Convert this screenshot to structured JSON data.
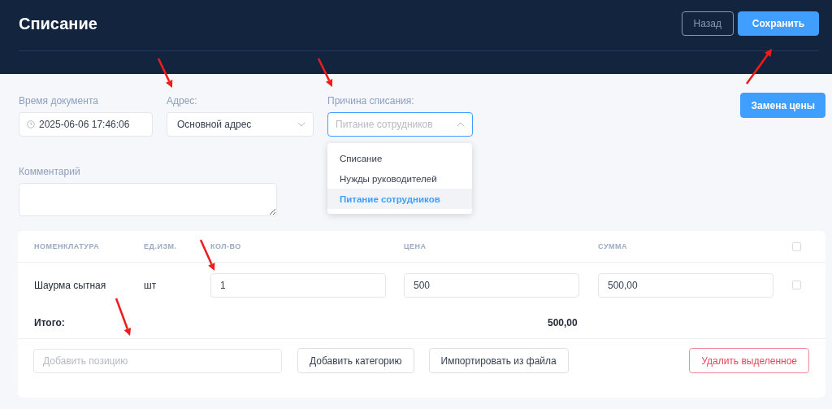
{
  "header": {
    "title": "Списание",
    "buttons": [
      {
        "label": "Назад",
        "kind": "outline"
      },
      {
        "label": "Сохранить",
        "kind": "primary"
      }
    ]
  },
  "form": {
    "time": {
      "label": "Время документа",
      "value": "2025-06-06 17:46:06"
    },
    "address": {
      "label": "Адрес:",
      "value": "Основной адрес",
      "expanded": false
    },
    "reason": {
      "label": "Причина списания:",
      "placeholder": "Питание сотрудников",
      "expanded": true,
      "options": [
        {
          "label": "Списание",
          "selected": false
        },
        {
          "label": "Нужды руководителей",
          "selected": false
        },
        {
          "label": "Питание сотрудников",
          "selected": true
        }
      ]
    },
    "comment": {
      "label": "Комментарий"
    },
    "replace_price_button": "Замена цены"
  },
  "table": {
    "columns": [
      "НОМЕНКЛАТУРА",
      "ЕД.ИЗМ.",
      "КОЛ-ВО",
      "ЦЕНА",
      "СУММА"
    ],
    "header_checked": false,
    "rows": [
      {
        "name": "Шаурма сытная",
        "unit": "шт",
        "quantity": "1",
        "price": "500",
        "sum": "500,00",
        "checked": false
      }
    ],
    "total_label": "Итого:",
    "total_value": "500,00"
  },
  "actions": {
    "add_position_placeholder": "Добавить позицию",
    "add_category": "Добавить категорию",
    "import": "Импортировать из файла",
    "delete_selected": "Удалить выделенное"
  }
}
